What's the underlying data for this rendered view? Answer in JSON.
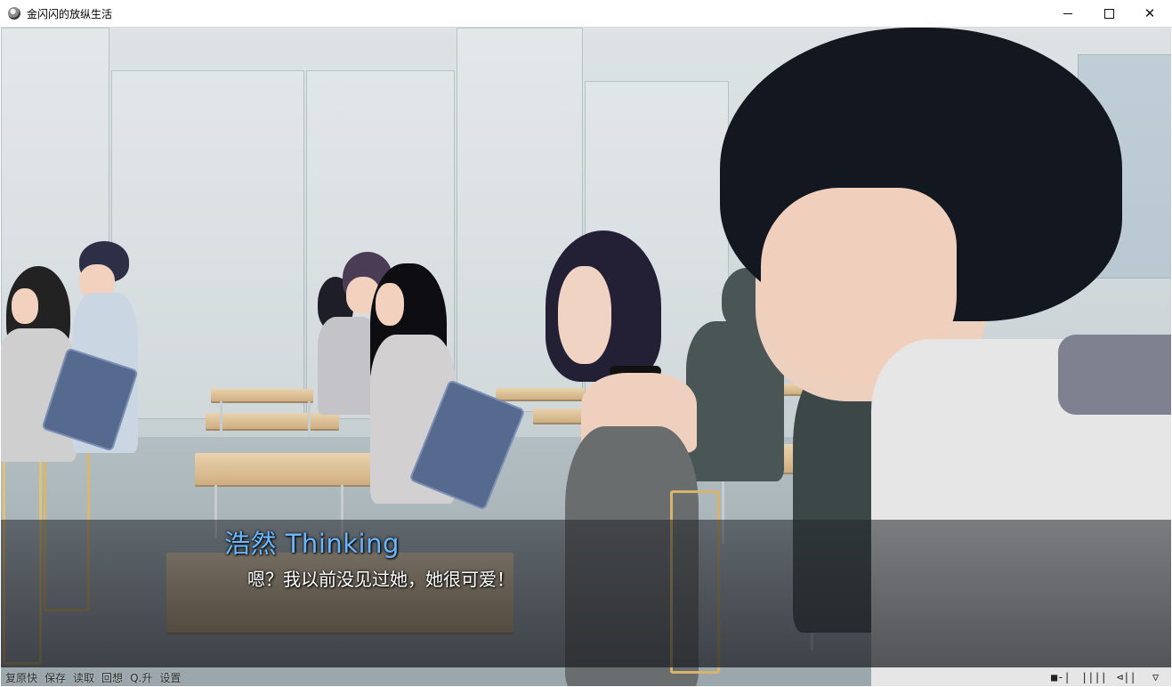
{
  "window": {
    "title": "金闪闪的放纵生活",
    "minimize_glyph": "",
    "maximize_glyph": "",
    "close_glyph": "✕"
  },
  "dialogue": {
    "speaker": "浩然 Thinking",
    "text": "嗯？我以前没见过她，她很可爱！",
    "speaker_color": "#6ab6ff"
  },
  "quick_menu": {
    "items": [
      "复原快",
      "保存",
      "读取",
      "回想",
      "Q.升",
      "设置"
    ]
  },
  "right_controls": {
    "items": [
      "■-|",
      "||||",
      "⊲||",
      "▽"
    ]
  },
  "icons": {
    "app": "game-app-icon",
    "minimize": "minimize-icon",
    "maximize": "maximize-icon",
    "close": "close-icon"
  }
}
